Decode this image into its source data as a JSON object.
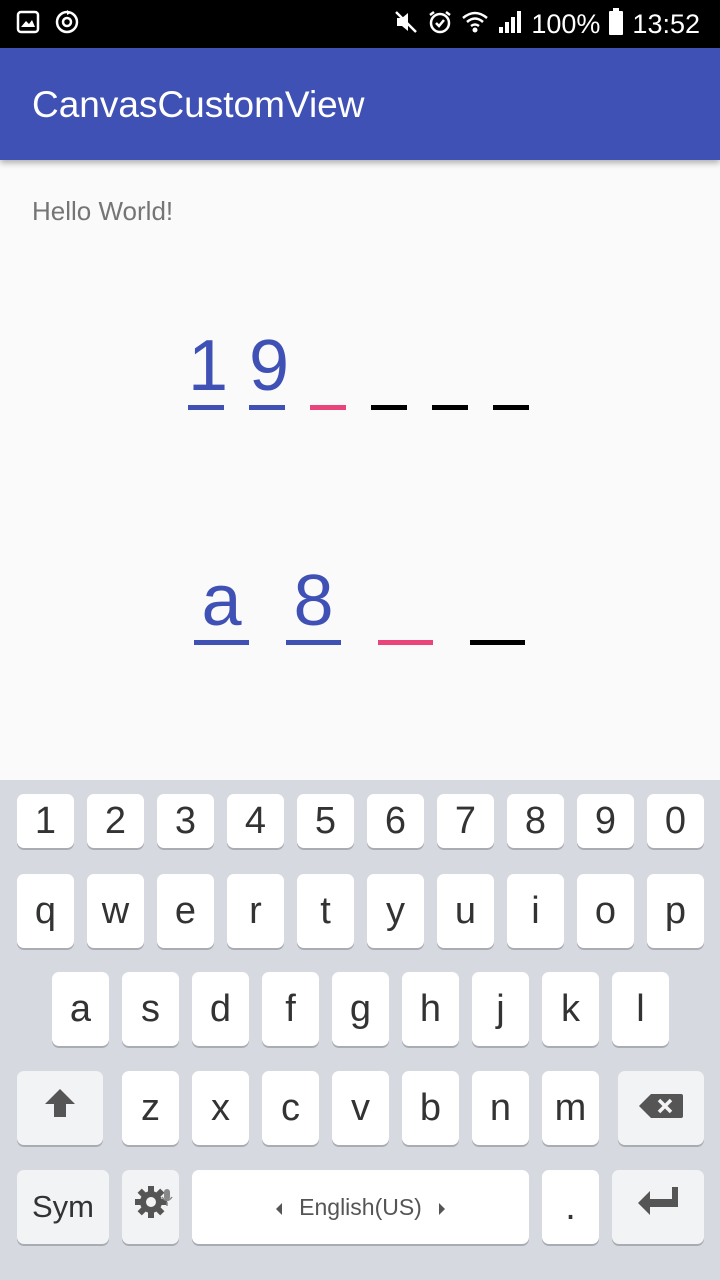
{
  "status_bar": {
    "battery": "100%",
    "time": "13:52",
    "left_icons": [
      "gallery-icon",
      "sync-icon"
    ],
    "right_icons": [
      "mute-icon",
      "alarm-icon",
      "wifi-icon",
      "signal-icon",
      "battery-icon"
    ]
  },
  "app_bar": {
    "title": "CanvasCustomView"
  },
  "content": {
    "hello": "Hello World!"
  },
  "pin_view_1": {
    "digits": [
      "1",
      "9",
      "",
      "",
      "",
      ""
    ],
    "states": [
      "filled",
      "filled",
      "active",
      "empty",
      "empty",
      "empty"
    ]
  },
  "pin_view_2": {
    "digits": [
      "a",
      "8",
      "",
      ""
    ],
    "states": [
      "filled",
      "filled",
      "active",
      "empty"
    ]
  },
  "keyboard": {
    "row_numbers": [
      "1",
      "2",
      "3",
      "4",
      "5",
      "6",
      "7",
      "8",
      "9",
      "0"
    ],
    "row_top": [
      "q",
      "w",
      "e",
      "r",
      "t",
      "y",
      "u",
      "i",
      "o",
      "p"
    ],
    "row_middle": [
      "a",
      "s",
      "d",
      "f",
      "g",
      "h",
      "j",
      "k",
      "l"
    ],
    "row_bottom": [
      "z",
      "x",
      "c",
      "v",
      "b",
      "n",
      "m"
    ],
    "sym_label": "Sym",
    "space_label": "English(US)",
    "period_label": ".",
    "colors": {
      "background": "#d6d9df",
      "key": "#ffffff",
      "accent": "#3f51b5",
      "active_underline": "#e9457a"
    }
  }
}
